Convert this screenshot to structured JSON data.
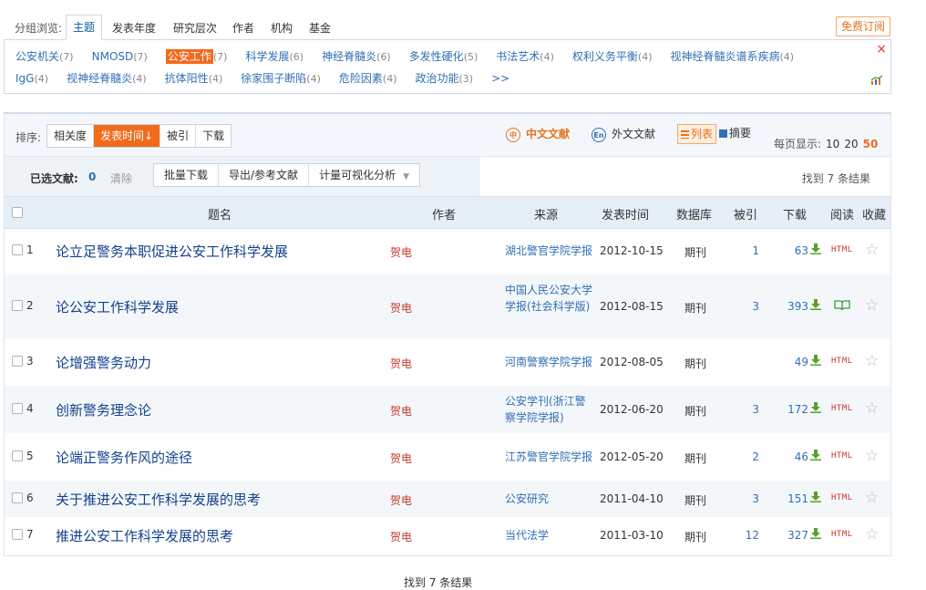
{
  "group_bar": {
    "label": "分组浏览:",
    "tabs": [
      "主题",
      "发表年度",
      "研究层次",
      "作者",
      "机构",
      "基金"
    ],
    "active_tab": 0,
    "subscribe": "免费订阅"
  },
  "topics": {
    "row1": [
      {
        "label": "公安机关",
        "count": "(7)"
      },
      {
        "label": "NMOSD",
        "count": "(7)"
      },
      {
        "label": "公安工作",
        "count": "(7)",
        "active": true
      },
      {
        "label": "科学发展",
        "count": "(6)"
      },
      {
        "label": "神经脊髓炎",
        "count": "(6)"
      },
      {
        "label": "多发性硬化",
        "count": "(5)"
      },
      {
        "label": "书法艺术",
        "count": "(4)"
      },
      {
        "label": "权利义务平衡",
        "count": "(4)"
      },
      {
        "label": "视神经脊髓炎谱系疾病",
        "count": "(4)"
      }
    ],
    "row2": [
      {
        "label": "IgG",
        "count": "(4)"
      },
      {
        "label": "视神经脊髓炎",
        "count": "(4)"
      },
      {
        "label": "抗体阳性",
        "count": "(4)"
      },
      {
        "label": "徐家围子断陷",
        "count": "(4)"
      },
      {
        "label": "危险因素",
        "count": "(4)"
      },
      {
        "label": "政治功能",
        "count": "(3)"
      }
    ],
    "more": ">>",
    "close": "×"
  },
  "sort_bar": {
    "label": "排序:",
    "options": [
      "相关度",
      "发表时间↓",
      "被引",
      "下载"
    ],
    "active": 1,
    "lang_zh": "中文文献",
    "lang_en": "外文文献",
    "view_list": "列表",
    "view_abstract": "摘要",
    "page_size_label": "每页显示:",
    "page_sizes": [
      "10",
      "20",
      "50"
    ],
    "page_size_active": 2
  },
  "toolbar": {
    "selected_label": "已选文献:",
    "selected_count": "0",
    "clear": "清除",
    "batch_download": "批量下载",
    "export": "导出/参考文献",
    "visualize": "计量可视化分析",
    "found": "找到 7 条结果"
  },
  "table": {
    "headers": {
      "title": "题名",
      "author": "作者",
      "source": "来源",
      "date": "发表时间",
      "db": "数据库",
      "cite": "被引",
      "download": "下载",
      "read": "阅读",
      "fav": "收藏"
    },
    "rows": [
      {
        "idx": "1",
        "title": "论立足警务本职促进公安工作科学发展",
        "author": "贺电",
        "source": "湖北警官学院学报",
        "date": "2012-10-15",
        "db": "期刊",
        "cite": "1",
        "download": "63",
        "read": "HTML"
      },
      {
        "idx": "2",
        "title": "论公安工作科学发展",
        "author": "贺电",
        "source": "中国人民公安大学学报(社会科学版)",
        "date": "2012-08-15",
        "db": "期刊",
        "cite": "3",
        "download": "393",
        "read": "book"
      },
      {
        "idx": "3",
        "title": "论增强警务动力",
        "author": "贺电",
        "source": "河南警察学院学报",
        "date": "2012-08-05",
        "db": "期刊",
        "cite": "",
        "download": "49",
        "read": "HTML"
      },
      {
        "idx": "4",
        "title": "创新警务理念论",
        "author": "贺电",
        "source": "公安学刊(浙江警察学院学报)",
        "date": "2012-06-20",
        "db": "期刊",
        "cite": "3",
        "download": "172",
        "read": "HTML"
      },
      {
        "idx": "5",
        "title": "论端正警务作风的途径",
        "author": "贺电",
        "source": "江苏警官学院学报",
        "date": "2012-05-20",
        "db": "期刊",
        "cite": "2",
        "download": "46",
        "read": "HTML"
      },
      {
        "idx": "6",
        "title": "关于推进公安工作科学发展的思考",
        "author": "贺电",
        "source": "公安研究",
        "date": "2011-04-10",
        "db": "期刊",
        "cite": "3",
        "download": "151",
        "read": "HTML"
      },
      {
        "idx": "7",
        "title": "推进公安工作科学发展的思考",
        "author": "贺电",
        "source": "当代法学",
        "date": "2011-03-10",
        "db": "期刊",
        "cite": "12",
        "download": "327",
        "read": "HTML"
      }
    ]
  },
  "footer": {
    "found": "找到 7 条结果"
  },
  "colors": {
    "accent": "#f26b1d",
    "link": "#2f6fb5",
    "title": "#13418d",
    "author": "#c0392b"
  }
}
